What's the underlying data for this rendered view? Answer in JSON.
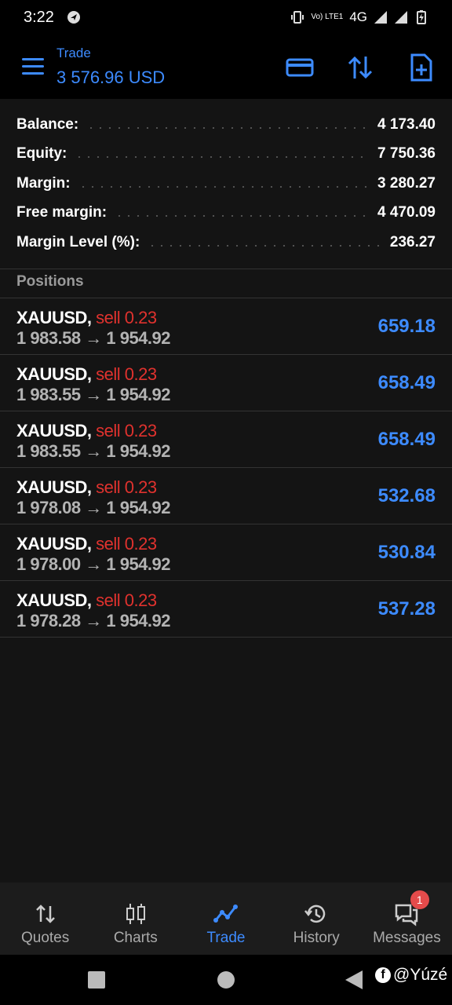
{
  "status_bar": {
    "time": "3:22",
    "network_label": "4G",
    "volte_label": "Vo) LTE1"
  },
  "app_bar": {
    "title": "Trade",
    "subtitle": "3 576.96 USD",
    "icons": [
      "menu-icon",
      "credit-card-icon",
      "sort-arrows-icon",
      "new-order-icon"
    ]
  },
  "summary": [
    {
      "label": "Balance:",
      "value": "4 173.40"
    },
    {
      "label": "Equity:",
      "value": "7 750.36"
    },
    {
      "label": "Margin:",
      "value": "3 280.27"
    },
    {
      "label": "Free margin:",
      "value": "4 470.09"
    },
    {
      "label": "Margin Level (%):",
      "value": "236.27"
    }
  ],
  "positions_header": "Positions",
  "positions": [
    {
      "symbol": "XAUUSD,",
      "side": "sell 0.23",
      "prices": "1 983.58 → 1 954.92",
      "profit": "659.18"
    },
    {
      "symbol": "XAUUSD,",
      "side": "sell 0.23",
      "prices": "1 983.55 → 1 954.92",
      "profit": "658.49"
    },
    {
      "symbol": "XAUUSD,",
      "side": "sell 0.23",
      "prices": "1 983.55 → 1 954.92",
      "profit": "658.49"
    },
    {
      "symbol": "XAUUSD,",
      "side": "sell 0.23",
      "prices": "1 978.08 → 1 954.92",
      "profit": "532.68"
    },
    {
      "symbol": "XAUUSD,",
      "side": "sell 0.23",
      "prices": "1 978.00 → 1 954.92",
      "profit": "530.84"
    },
    {
      "symbol": "XAUUSD,",
      "side": "sell 0.23",
      "prices": "1 978.28 → 1 954.92",
      "profit": "537.28"
    }
  ],
  "bottom_nav": [
    {
      "label": "Quotes",
      "icon": "quotes-arrows-icon"
    },
    {
      "label": "Charts",
      "icon": "candlestick-icon"
    },
    {
      "label": "Trade",
      "icon": "trade-line-icon",
      "active": true
    },
    {
      "label": "History",
      "icon": "history-icon"
    },
    {
      "label": "Messages",
      "icon": "messages-icon",
      "badge": "1"
    }
  ],
  "watermark": {
    "text": "@Yúzé",
    "logo": "f"
  },
  "colors": {
    "accent": "#3d8bff",
    "sell": "#e0322e",
    "background": "#141414",
    "badge": "#e54b4b"
  }
}
